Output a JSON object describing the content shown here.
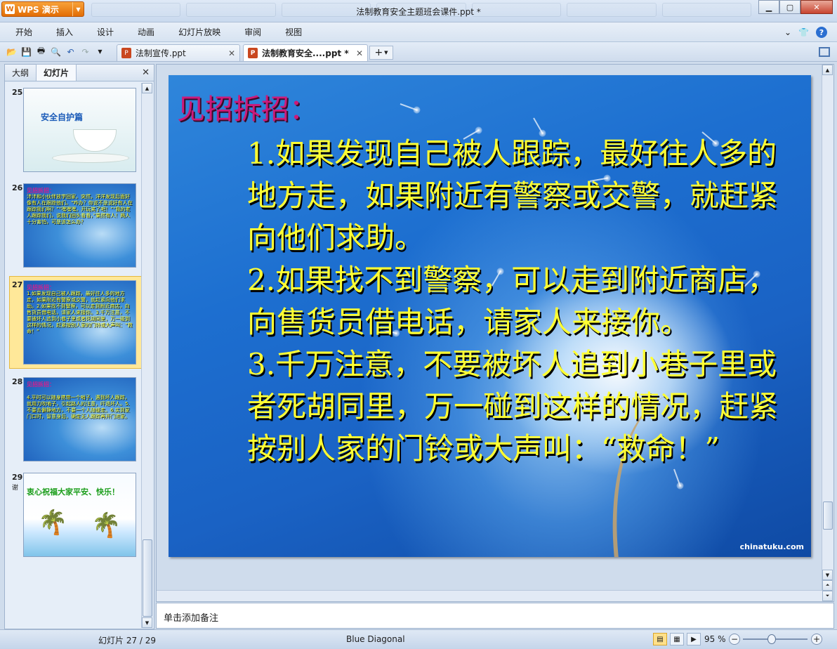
{
  "app": {
    "brand_label": "WPS 演示",
    "window_title": "法制教育安全主题班会课件.ppt *",
    "icons": [
      "wps-logo-icon",
      "minimize-icon",
      "maximize-icon",
      "close-icon"
    ]
  },
  "menu": {
    "items": [
      "开始",
      "插入",
      "设计",
      "动画",
      "幻灯片放映",
      "审阅",
      "视图"
    ],
    "right_icons": [
      "chevron-down-icon",
      "shirt-skin-icon",
      "help-icon"
    ]
  },
  "doc_tabs": [
    {
      "label": "法制宣传.ppt",
      "active": false
    },
    {
      "label": "法制教育安全....ppt *",
      "active": true
    }
  ],
  "left_pane": {
    "tabs": [
      "大纲",
      "幻灯片"
    ],
    "active_tab": "幻灯片",
    "thumbnails": [
      {
        "number": "25",
        "title": "安全自护篇"
      },
      {
        "number": "26",
        "title": "见招拆招：",
        "text": "泮泮和小伙伴放学回家，突然，洋洋发现后面好像有人在跟踪他们。“咋办？你说不是说好有人在跟踪我们啊？”“嘿嘿嘿，开玩笑了吧！”“我的老人跟踪我们，说我们回头看看，”果然有人！两人十分害怕，可是该怎么办？"
      },
      {
        "number": "27",
        "title": "见招拆招：",
        "text": "1.如果发现自己被人跟踪，最好往人多的地方走，如果附近有警察或交警，就赶紧向他们求助。2.如果找不到警察，可以走到附近商店，向售货员借电话，请家人来接你。3.千万注意，不要被坏人追到小巷子里或者死胡同里，万一碰到这样的情况，赶紧按别人家的门铃或大声叫：“救命！”",
        "selected": true
      },
      {
        "number": "28",
        "title": "见招拆招：",
        "text": "4.平时可以随身携带一个哨子，遇到坏人跟踪，就用力吹哨子，引起路人的注意，吓退坏人。5.不要去僻静地方，不要一个人随便走。6.实到家门口时，留意身后，确定无人跟踪再开门进家。"
      },
      {
        "number": "29",
        "title": "衷心祝福大家平安、快乐！",
        "side_label": "谢"
      }
    ]
  },
  "slide": {
    "title": "见招拆招：",
    "paragraphs": [
      "1.如果发现自己被人跟踪，最好往人多的地方走，如果附近有警察或交警，就赶紧向他们求助。",
      "2.如果找不到警察，可以走到附近商店，向售货员借电话，请家人来接你。",
      "3.千万注意，不要被坏人追到小巷子里或者死胡同里，万一碰到这样的情况，赶紧按别人家的门铃或大声叫：“救命！”"
    ],
    "watermark": "chinatuku.com"
  },
  "notes_placeholder": "单击添加备注",
  "status": {
    "slide_counter": "幻灯片 27 / 29",
    "theme_name": "Blue Diagonal",
    "zoom_label": "95 %",
    "zoom_percent": 95
  },
  "colors": {
    "slide_title": "#cc1a7a",
    "slide_text": "#ffff33",
    "wps_orange": "#e26d06"
  }
}
